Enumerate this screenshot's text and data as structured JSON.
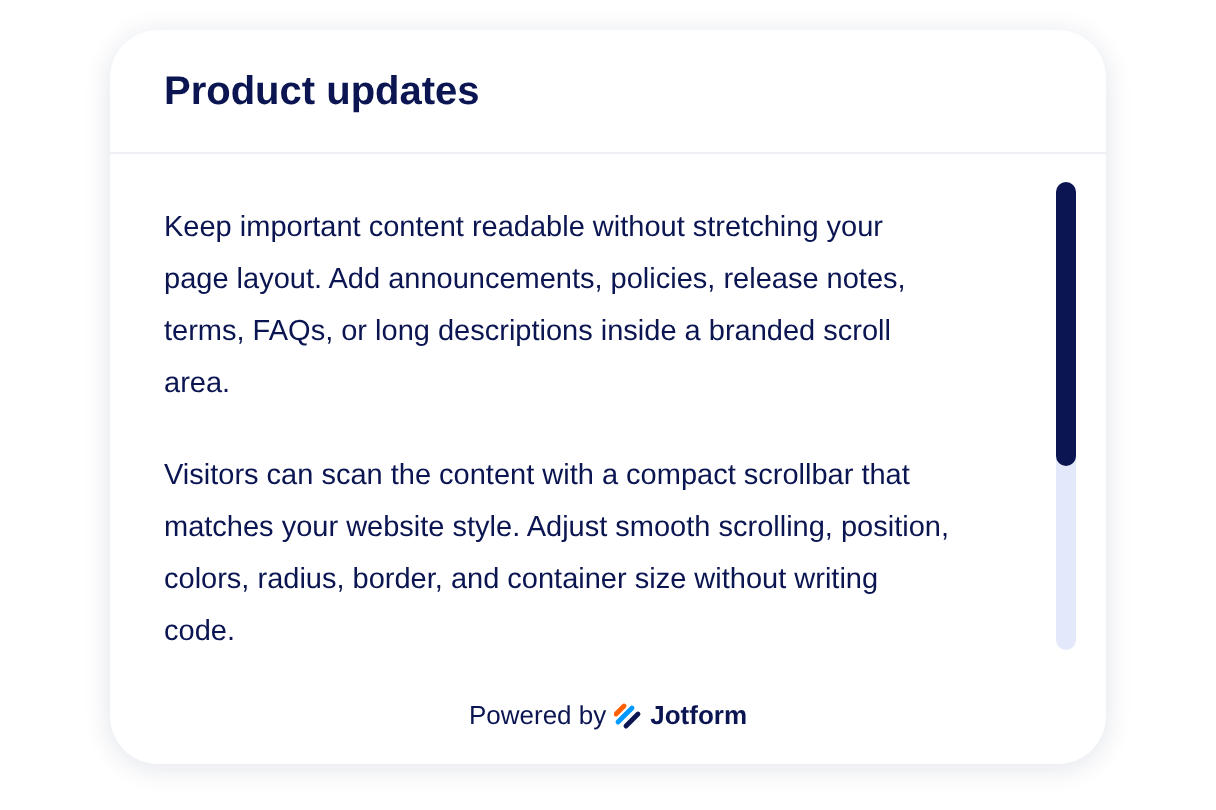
{
  "card": {
    "title": "Product updates",
    "paragraphs": [
      "Keep important content readable without stretching your page layout. Add announcements, policies, release notes, terms, FAQs, or long descriptions inside a branded scroll area.",
      "Visitors can scan the content with a compact scrollbar that matches your website style. Adjust smooth scrolling, position, colors, radius, border, and container size without writing code."
    ],
    "footer": {
      "label": "Powered by",
      "brand": "Jotform"
    }
  }
}
